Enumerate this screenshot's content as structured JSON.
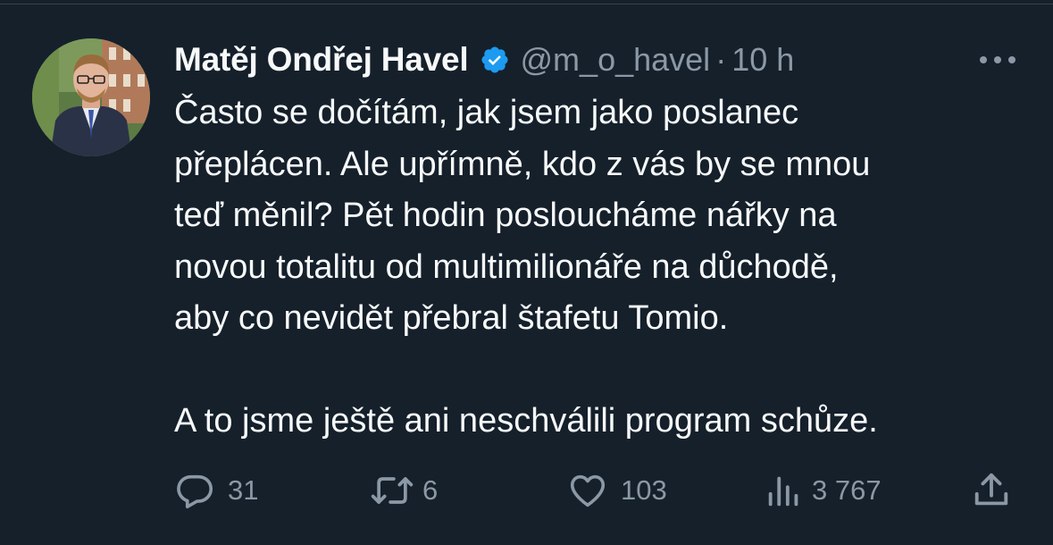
{
  "tweet": {
    "author": {
      "display_name": "Matěj Ondřej Havel",
      "handle": "@m_o_havel",
      "verified": true,
      "avatar_icon": "profile-photo"
    },
    "separator": "·",
    "timestamp": "10 h",
    "text_lines": [
      "Často se dočítám, jak jsem jako poslanec",
      "přeplácen. Ale upřímně, kdo z vás by se mnou",
      "teď měnil? Pět hodin posloucháme nářky na",
      "novou totalitu od multimilionáře na důchodě,",
      "aby co nevidět přebral štafetu Tomio.",
      "A to jsme ještě ani neschválili program schůze."
    ],
    "actions": {
      "replies": "31",
      "retweets": "6",
      "likes": "103",
      "views": "3 767"
    },
    "icons": {
      "more": "more-dots-icon",
      "reply": "reply-bubble-icon",
      "retweet": "retweet-icon",
      "like": "heart-icon",
      "views": "analytics-bars-icon",
      "share": "share-upload-icon",
      "verified": "verified-badge-icon"
    }
  },
  "colors": {
    "background": "#15202b",
    "text_primary": "#f7f9f9",
    "text_secondary": "#8b98a5",
    "verified_blue": "#1d9bf0",
    "divider": "#38444d"
  }
}
